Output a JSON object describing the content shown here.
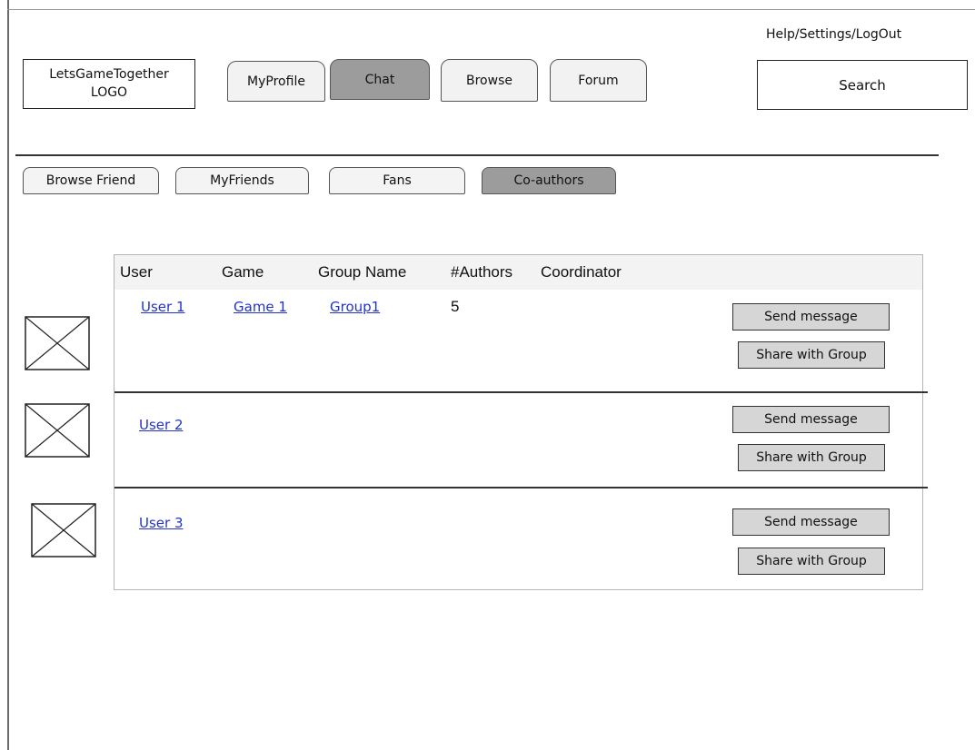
{
  "header": {
    "logo_line1": "LetsGameTogether",
    "logo_line2": "LOGO",
    "nav": {
      "myprofile": "MyProfile",
      "chat": "Chat",
      "browse": "Browse",
      "forum": "Forum"
    },
    "help_links": "Help/Settings/LogOut",
    "search_label": "Search"
  },
  "subnav": {
    "browse_friend": "Browse Friend",
    "myfriends": "MyFriends",
    "fans": "Fans",
    "coauthors": "Co-authors"
  },
  "table": {
    "columns": {
      "user": "User",
      "game": "Game",
      "group_name": "Group Name",
      "authors": "#Authors",
      "coordinator": "Coordinator"
    },
    "rows": [
      {
        "user": "User 1",
        "game": "Game 1",
        "group": "Group1",
        "authors": "5"
      },
      {
        "user": "User 2"
      },
      {
        "user": "User 3"
      }
    ],
    "send_message": "Send message",
    "share_with_group": "Share with Group"
  },
  "colors": {
    "active_tab": "#9c9c9c",
    "tab": "#f2f2f2",
    "button": "#d6d6d6",
    "link": "#2233cc"
  }
}
